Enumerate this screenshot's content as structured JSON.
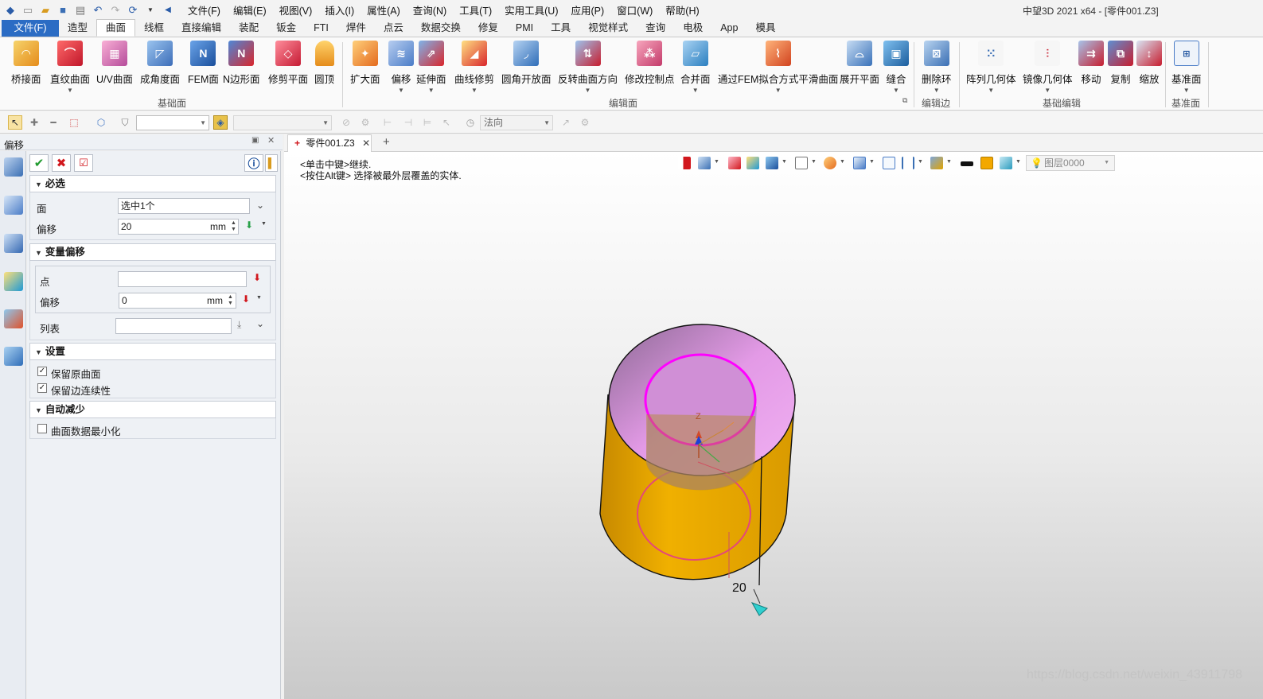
{
  "titlebar": {
    "menus": [
      "文件(F)",
      "编辑(E)",
      "视图(V)",
      "插入(I)",
      "属性(A)",
      "查询(N)",
      "工具(T)",
      "实用工具(U)",
      "应用(P)",
      "窗口(W)",
      "帮助(H)"
    ],
    "app_title": "中望3D 2021 x64 - [零件001.Z3]"
  },
  "ribbon_tabs": [
    "文件(F)",
    "造型",
    "曲面",
    "线框",
    "直接编辑",
    "装配",
    "钣金",
    "FTI",
    "焊件",
    "点云",
    "数据交换",
    "修复",
    "PMI",
    "工具",
    "视觉样式",
    "查询",
    "电极",
    "App",
    "模具"
  ],
  "active_tab": "曲面",
  "ribbon": {
    "groups": {
      "basic_surface": "基础面",
      "edit_surface": "编辑面",
      "edit_edge": "编辑边",
      "basic_edit": "基础编辑",
      "datum": "基准面"
    },
    "buttons": {
      "bridge": "桥接面",
      "ruled": "直纹曲面",
      "uv": "U/V曲面",
      "angled": "成角度面",
      "fem": "FEM面",
      "nside": "N边形面",
      "trim_plane": "修剪平面",
      "dome": "圆顶",
      "extend": "扩大面",
      "offset": "偏移",
      "extend_surface": "延伸面",
      "curve_trim": "曲线修剪",
      "fillet_open": "圆角开放面",
      "reverse_dir": "反转曲面方向",
      "modify_ctrl": "修改控制点",
      "merge": "合并面",
      "fem_fit": "通过FEM拟合方式平滑曲面",
      "unfold": "展开平面",
      "sew": "缝合",
      "delete_loop": "删除环",
      "pattern": "阵列几何体",
      "mirror": "镜像几何体",
      "move": "移动",
      "copy": "复制",
      "scale": "缩放",
      "datum_plane": "基准面"
    }
  },
  "toolbar": {
    "direction_combo": "法向"
  },
  "panel": {
    "title": "偏移",
    "required": {
      "header": "必选",
      "face_label": "面",
      "face_value": "选中1个",
      "offset_label": "偏移",
      "offset_value": "20",
      "offset_unit": "mm"
    },
    "variable_offset": {
      "header": "变量偏移",
      "point_label": "点",
      "point_value": "",
      "offset_label": "偏移",
      "offset_value": "0",
      "offset_unit": "mm",
      "list_label": "列表",
      "list_value": ""
    },
    "settings": {
      "header": "设置",
      "keep_original": "保留原曲面",
      "keep_original_checked": true,
      "keep_continuity": "保留边连续性",
      "keep_continuity_checked": true
    },
    "auto_reduce": {
      "header": "自动减少",
      "minimize": "曲面数据最小化",
      "minimize_checked": false
    }
  },
  "document": {
    "tab_label": "零件001.Z3"
  },
  "viewport": {
    "prompt_line1": "<单击中键>继续.",
    "prompt_line2": "<按住Alt键> 选择被最外层覆盖的实体.",
    "layer": "图层0000",
    "dimension_label": "20",
    "axis_label": "Z"
  },
  "watermark": "https://blog.csdn.net/weixin_43911798",
  "colors": {
    "file_tab": "#2b6cc4",
    "solid_side": "#e0a300",
    "inner_face": "#e8a0e8",
    "selected_edge": "#ff00ff"
  }
}
